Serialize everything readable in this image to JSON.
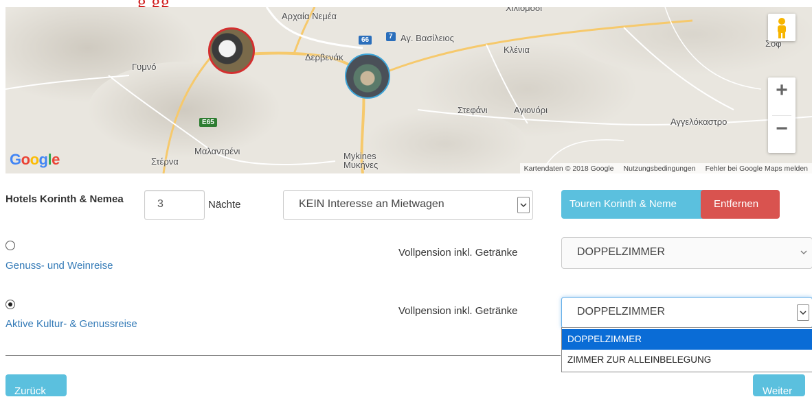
{
  "header": {
    "heading_partial": "g                                                    gg"
  },
  "map": {
    "places": [
      {
        "id": "ancient-nemea",
        "label": "Αρχαία Νεμέα"
      },
      {
        "id": "chiliomodi",
        "label": "Χιλιόμοδι"
      },
      {
        "id": "ag-vasileios",
        "label": "Αγ. Βασίλειος"
      },
      {
        "id": "klenia",
        "label": "Κλένια"
      },
      {
        "id": "gymno",
        "label": "Γυμνό"
      },
      {
        "id": "dervenaki",
        "label": "Δερβενάκ"
      },
      {
        "id": "stefani",
        "label": "Στεφάνι"
      },
      {
        "id": "agionori",
        "label": "Αγιονόρι"
      },
      {
        "id": "aggelokastro",
        "label": "Αγγελόκαστρο"
      },
      {
        "id": "malantreni",
        "label": "Μαλαντρένι"
      },
      {
        "id": "sterna",
        "label": "Στέρνα"
      },
      {
        "id": "mykines",
        "label": "Mykines"
      },
      {
        "id": "mykines-gr",
        "label": "Μυκήνες"
      },
      {
        "id": "sofiko",
        "label": "Σοφ"
      }
    ],
    "shields": {
      "route66": "66",
      "route7": "7",
      "e65": "E65"
    },
    "logo_letters": [
      "G",
      "o",
      "o",
      "g",
      "l",
      "e"
    ],
    "logo_colors": [
      "#4285F4",
      "#EA4335",
      "#FBBC05",
      "#4285F4",
      "#34A853",
      "#EA4335"
    ],
    "attribution": {
      "data": "Kartendaten © 2018 Google",
      "terms": "Nutzungsbedingungen",
      "report": "Fehler bei Google Maps melden"
    },
    "controls": {
      "zoom_in": "+",
      "zoom_out": "−"
    }
  },
  "hotel_row": {
    "title": "Hotels Korinth & Nemea",
    "nights_value": "3",
    "nights_label": "Nächte",
    "car_select": "KEIN Interesse an Mietwagen",
    "tours_button": "Touren Korinth & Neme",
    "remove_button": "Entfernen"
  },
  "options": [
    {
      "name": "Genuss- und Weinreise",
      "selected": false,
      "board": "Vollpension inkl. Getränke",
      "room": "DOPPELZIMMER"
    },
    {
      "name": "Aktive Kultur- & Genussreise",
      "selected": true,
      "board": "Vollpension inkl. Getränke",
      "room": "DOPPELZIMMER"
    }
  ],
  "room_dropdown": {
    "items": [
      "DOPPELZIMMER",
      "ZIMMER ZUR ALLEINBELEGUNG"
    ],
    "highlighted": "DOPPELZIMMER"
  },
  "nav": {
    "back": "Zurück",
    "next": "Weiter"
  },
  "colors": {
    "info": "#5bc0de",
    "danger": "#d9534f",
    "link": "#337ab7",
    "highlight": "#0a6cd6"
  }
}
